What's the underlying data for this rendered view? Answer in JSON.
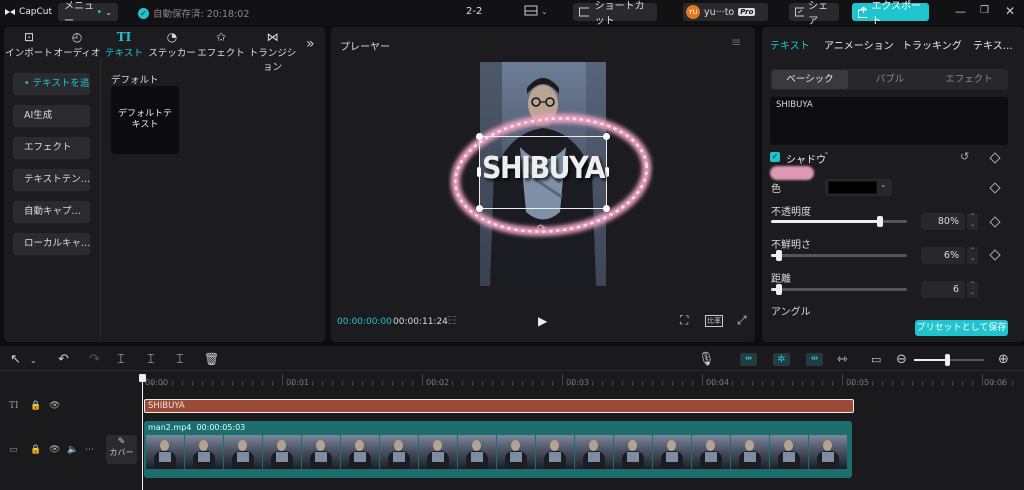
{
  "app": {
    "name": "CapCut"
  },
  "topbar": {
    "menu_label": "メニュー",
    "autosave_text": "自動保存済: 20:18:02",
    "project_title": "2-2",
    "shortcut_label": "ショートカット",
    "user_initials": "YU",
    "user_name": "yu···to",
    "pro_badge": "Pro",
    "share_label": "シェア",
    "export_label": "エクスポート"
  },
  "media_tabs": [
    {
      "label": "インポート",
      "icon": "import-icon"
    },
    {
      "label": "オーディオ",
      "icon": "audio-icon"
    },
    {
      "label": "テキスト",
      "icon": "text-icon"
    },
    {
      "label": "ステッカー",
      "icon": "sticker-icon"
    },
    {
      "label": "エフェクト",
      "icon": "effect-icon"
    },
    {
      "label": "トランジション",
      "icon": "transition-icon"
    }
  ],
  "text_sidebar": [
    {
      "label": "• テキストを追加",
      "active": true
    },
    {
      "label": "AI生成"
    },
    {
      "label": "エフェクト"
    },
    {
      "label": "テキストテン…"
    },
    {
      "label": "自動キャプ…"
    },
    {
      "label": "ローカルキャ…"
    }
  ],
  "text_library": {
    "section_title": "デフォルト",
    "card_label": "デフォルトテキスト"
  },
  "player": {
    "title": "プレーヤー",
    "overlay_text": "SHIBUYA",
    "current_time": "00:00:00:00",
    "total_time": "00:00:11:24",
    "ratio_label": "比率"
  },
  "right_panel": {
    "tabs": [
      "テキスト",
      "アニメーション",
      "トラッキング",
      "テキス…"
    ],
    "style_segments": [
      "ベーシック",
      "バブル",
      "エフェクト"
    ],
    "text_value": "SHIBUYA",
    "shadow_label": "シャドウ",
    "color_label": "色",
    "opacity_label": "不透明度",
    "opacity_value": "80%",
    "opacity_level": 0.8,
    "blur_label": "不鮮明さ",
    "blur_value": "6%",
    "blur_level": 0.06,
    "distance_label": "距離",
    "distance_value": "6",
    "distance_level": 0.06,
    "angle_label": "アングル",
    "save_preset_label": "プリセットとして保存"
  },
  "timeline": {
    "ruler_labels": [
      "00:00",
      "00:01",
      "00:02",
      "00:03",
      "00:04",
      "00:05",
      "00:06"
    ],
    "text_clip_label": "SHIBUYA",
    "video_clip_name": "man2.mp4",
    "video_clip_duration": "00:00:05:03",
    "cover_label": "カバー"
  },
  "colors": {
    "accent": "#20c4cf",
    "text_clip": "#9b4a37",
    "video_clip": "#1c6e6d",
    "glow": "#f4a6c4"
  }
}
